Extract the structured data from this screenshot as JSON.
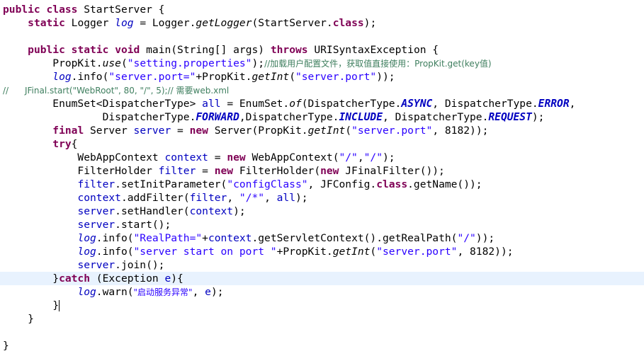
{
  "editor": {
    "language": "java",
    "current_line_index": 20,
    "colors": {
      "keyword": "#7f0055",
      "field": "#0000c0",
      "string": "#2a00ff",
      "comment": "#3f7f5f",
      "current_line": "#e8f2fe",
      "background": "#ffffff"
    },
    "lines": [
      [
        [
          "kw",
          "public"
        ],
        [
          "p",
          " "
        ],
        [
          "kw",
          "class"
        ],
        [
          "p",
          " StartServer {"
        ]
      ],
      [
        [
          "p",
          "    "
        ],
        [
          "kw",
          "static"
        ],
        [
          "p",
          " Logger "
        ],
        [
          "sfld",
          "log"
        ],
        [
          "p",
          " = Logger."
        ],
        [
          "sm",
          "getLogger"
        ],
        [
          "p",
          "(StartServer."
        ],
        [
          "kw",
          "class"
        ],
        [
          "p",
          ");"
        ]
      ],
      [],
      [
        [
          "p",
          "    "
        ],
        [
          "kw",
          "public"
        ],
        [
          "p",
          " "
        ],
        [
          "kw",
          "static"
        ],
        [
          "p",
          " "
        ],
        [
          "kw",
          "void"
        ],
        [
          "p",
          " main(String[] args) "
        ],
        [
          "kw",
          "throws"
        ],
        [
          "p",
          " URISyntaxException {"
        ]
      ],
      [
        [
          "p",
          "        PropKit."
        ],
        [
          "sm",
          "use"
        ],
        [
          "p",
          "("
        ],
        [
          "str",
          "\"setting.properties\""
        ],
        [
          "p",
          ");"
        ],
        [
          "cmt",
          "//加载用户配置文件，获取值直接使用：PropKit.get(key值)"
        ]
      ],
      [
        [
          "p",
          "        "
        ],
        [
          "sfld",
          "log"
        ],
        [
          "p",
          ".info("
        ],
        [
          "str",
          "\"server.port=\""
        ],
        [
          "p",
          "+PropKit."
        ],
        [
          "sm",
          "getInt"
        ],
        [
          "p",
          "("
        ],
        [
          "str",
          "\"server.port\""
        ],
        [
          "p",
          "));"
        ]
      ],
      [
        [
          "cmt",
          "//      JFinal.start(\"WebRoot\", 80, \"/\", 5);// 需要web.xml"
        ]
      ],
      [
        [
          "p",
          "        EnumSet<DispatcherType> "
        ],
        [
          "fld",
          "all"
        ],
        [
          "p",
          " = EnumSet."
        ],
        [
          "sm",
          "of"
        ],
        [
          "p",
          "(DispatcherType."
        ],
        [
          "sfldb",
          "ASYNC"
        ],
        [
          "p",
          ", DispatcherType."
        ],
        [
          "sfldb",
          "ERROR"
        ],
        [
          "p",
          ","
        ]
      ],
      [
        [
          "p",
          "                DispatcherType."
        ],
        [
          "sfldb",
          "FORWARD"
        ],
        [
          "p",
          ",DispatcherType."
        ],
        [
          "sfldb",
          "INCLUDE"
        ],
        [
          "p",
          ", DispatcherType."
        ],
        [
          "sfldb",
          "REQUEST"
        ],
        [
          "p",
          ");"
        ]
      ],
      [
        [
          "p",
          "        "
        ],
        [
          "kw",
          "final"
        ],
        [
          "p",
          " Server "
        ],
        [
          "fld",
          "server"
        ],
        [
          "p",
          " = "
        ],
        [
          "kw",
          "new"
        ],
        [
          "p",
          " Server(PropKit."
        ],
        [
          "sm",
          "getInt"
        ],
        [
          "p",
          "("
        ],
        [
          "str",
          "\"server.port\""
        ],
        [
          "p",
          ", 8182));"
        ]
      ],
      [
        [
          "p",
          "        "
        ],
        [
          "kw",
          "try"
        ],
        [
          "p",
          "{"
        ]
      ],
      [
        [
          "p",
          "            WebAppContext "
        ],
        [
          "fld",
          "context"
        ],
        [
          "p",
          " = "
        ],
        [
          "kw",
          "new"
        ],
        [
          "p",
          " WebAppContext("
        ],
        [
          "str",
          "\"/\""
        ],
        [
          "p",
          ","
        ],
        [
          "str",
          "\"/\""
        ],
        [
          "p",
          ");"
        ]
      ],
      [
        [
          "p",
          "            FilterHolder "
        ],
        [
          "fld",
          "filter"
        ],
        [
          "p",
          " = "
        ],
        [
          "kw",
          "new"
        ],
        [
          "p",
          " FilterHolder("
        ],
        [
          "kw",
          "new"
        ],
        [
          "p",
          " JFinalFilter());"
        ]
      ],
      [
        [
          "p",
          "            "
        ],
        [
          "fld",
          "filter"
        ],
        [
          "p",
          ".setInitParameter("
        ],
        [
          "str",
          "\"configClass\""
        ],
        [
          "p",
          ", JFConfig."
        ],
        [
          "kw",
          "class"
        ],
        [
          "p",
          ".getName());"
        ]
      ],
      [
        [
          "p",
          "            "
        ],
        [
          "fld",
          "context"
        ],
        [
          "p",
          ".addFilter("
        ],
        [
          "fld",
          "filter"
        ],
        [
          "p",
          ", "
        ],
        [
          "str",
          "\"/*\""
        ],
        [
          "p",
          ", "
        ],
        [
          "fld",
          "all"
        ],
        [
          "p",
          ");"
        ]
      ],
      [
        [
          "p",
          "            "
        ],
        [
          "fld",
          "server"
        ],
        [
          "p",
          ".setHandler("
        ],
        [
          "fld",
          "context"
        ],
        [
          "p",
          ");"
        ]
      ],
      [
        [
          "p",
          "            "
        ],
        [
          "fld",
          "server"
        ],
        [
          "p",
          ".start();"
        ]
      ],
      [
        [
          "p",
          "            "
        ],
        [
          "sfld",
          "log"
        ],
        [
          "p",
          ".info("
        ],
        [
          "str",
          "\"RealPath=\""
        ],
        [
          "p",
          "+"
        ],
        [
          "fld",
          "context"
        ],
        [
          "p",
          ".getServletContext().getRealPath("
        ],
        [
          "str",
          "\"/\""
        ],
        [
          "p",
          "));"
        ]
      ],
      [
        [
          "p",
          "            "
        ],
        [
          "sfld",
          "log"
        ],
        [
          "p",
          ".info("
        ],
        [
          "str",
          "\"server start on port \""
        ],
        [
          "p",
          "+PropKit."
        ],
        [
          "sm",
          "getInt"
        ],
        [
          "p",
          "("
        ],
        [
          "str",
          "\"server.port\""
        ],
        [
          "p",
          ", 8182));"
        ]
      ],
      [
        [
          "p",
          "            "
        ],
        [
          "fld",
          "server"
        ],
        [
          "p",
          ".join();"
        ]
      ],
      [
        [
          "p",
          "        }"
        ],
        [
          "kw",
          "catch"
        ],
        [
          "p",
          " (Exception "
        ],
        [
          "fld",
          "e"
        ],
        [
          "p",
          "){"
        ]
      ],
      [
        [
          "p",
          "            "
        ],
        [
          "sfld",
          "log"
        ],
        [
          "p",
          ".warn("
        ],
        [
          "str",
          "\"启动服务异常\""
        ],
        [
          "p",
          ", "
        ],
        [
          "fld",
          "e"
        ],
        [
          "p",
          ");"
        ]
      ],
      [
        [
          "p",
          "        }"
        ]
      ],
      [
        [
          "p",
          "    }"
        ]
      ],
      [],
      [
        [
          "p",
          "}"
        ]
      ]
    ]
  }
}
